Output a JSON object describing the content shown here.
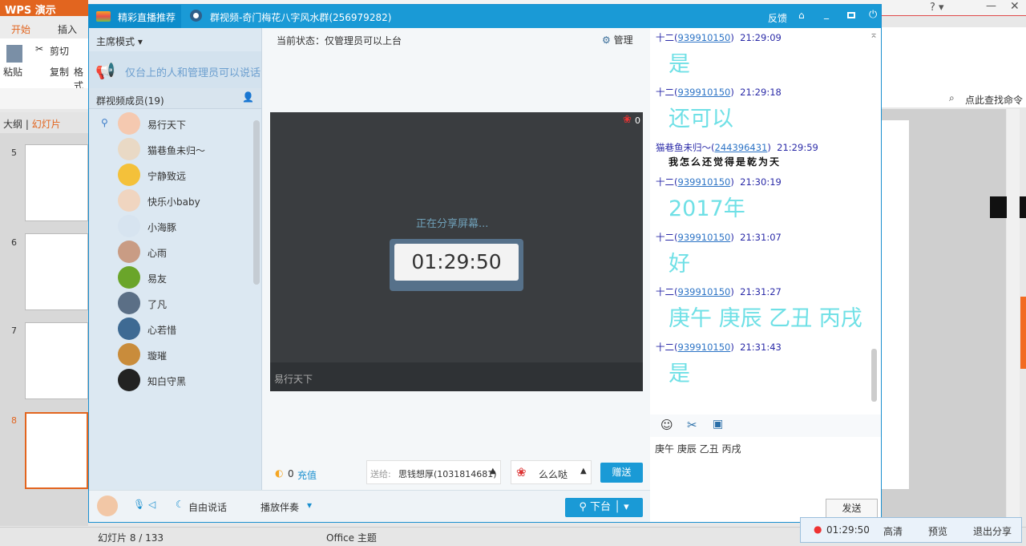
{
  "wps": {
    "app_title": "WPS 演示",
    "tabs": [
      "开始",
      "插入"
    ],
    "ribbon": {
      "paste": "粘贴",
      "cut": "剪切",
      "copy": "复制",
      "format": "格式"
    },
    "outline_tab": "大纲",
    "slides_tab": "幻灯片",
    "slide_numbers": [
      "5",
      "6",
      "7",
      "8"
    ],
    "search_command": "点此查找命令",
    "status": {
      "slide": "幻灯片 8 / 133",
      "theme": "Office 主题"
    }
  },
  "qq": {
    "tab_live": "精彩直播推荐",
    "tab_group": "群视频-奇门梅花八字风水群(256979282)",
    "title_feedback": "反馈",
    "mode": "主席模式",
    "notice": "仅台上的人和管理员可以说话",
    "members_header": "群视频成员(19)",
    "members": [
      {
        "name": "易行天下",
        "color": "#f5c9b0"
      },
      {
        "name": "猫巷鱼未归～",
        "color": "#e9d9c5"
      },
      {
        "name": "宁静致远",
        "color": "#f4c13a"
      },
      {
        "name": "快乐小baby",
        "color": "#f0d5c0"
      },
      {
        "name": "小海豚",
        "color": "#d7e4f0"
      },
      {
        "name": "心雨",
        "color": "#c99c84"
      },
      {
        "name": "易友",
        "color": "#6aa52a"
      },
      {
        "name": "了凡",
        "color": "#5b6f86"
      },
      {
        "name": "心若惜",
        "color": "#3e6a93"
      },
      {
        "name": "璇璀",
        "color": "#c98c3b"
      },
      {
        "name": "知白守黑",
        "color": "#222222"
      }
    ],
    "status": "当前状态：仅管理员可以上台",
    "manage": "管理",
    "rose_count": "0",
    "sharing": "正在分享屏幕...",
    "timer": "01:29:50",
    "video_owner": "易行天下",
    "coins": "0",
    "recharge": "充值",
    "send_to_label": "送给:",
    "send_to": "思钱想厚(1031814681)",
    "gift": "么么哒",
    "give": "赠送",
    "free_talk": "自由说话",
    "accompany": "播放伴奏",
    "leave_stage": "下台",
    "chat": [
      {
        "user": "十二",
        "qq": "939910150",
        "time": "21:29:09",
        "text": "是"
      },
      {
        "user": "十二",
        "qq": "939910150",
        "time": "21:29:18",
        "text": "还可以"
      },
      {
        "user": "猫巷鱼未归～",
        "qq": "244396431",
        "time": "21:29:59",
        "text": "我怎么还觉得是乾为天"
      },
      {
        "user": "十二",
        "qq": "939910150",
        "time": "21:30:19",
        "text": "2017年"
      },
      {
        "user": "十二",
        "qq": "939910150",
        "time": "21:31:07",
        "text": "好"
      },
      {
        "user": "十二",
        "qq": "939910150",
        "time": "21:31:27",
        "text": "庚午 庚辰 乙丑 丙戌"
      },
      {
        "user": "十二",
        "qq": "939910150",
        "time": "21:31:43",
        "text": "是"
      }
    ],
    "input_text": "庚午 庚辰 乙丑 丙戌",
    "send": "发送",
    "share_bar": {
      "timer": "01:29:50",
      "hd": "高清",
      "preview": "预览",
      "exit": "退出分享"
    }
  }
}
